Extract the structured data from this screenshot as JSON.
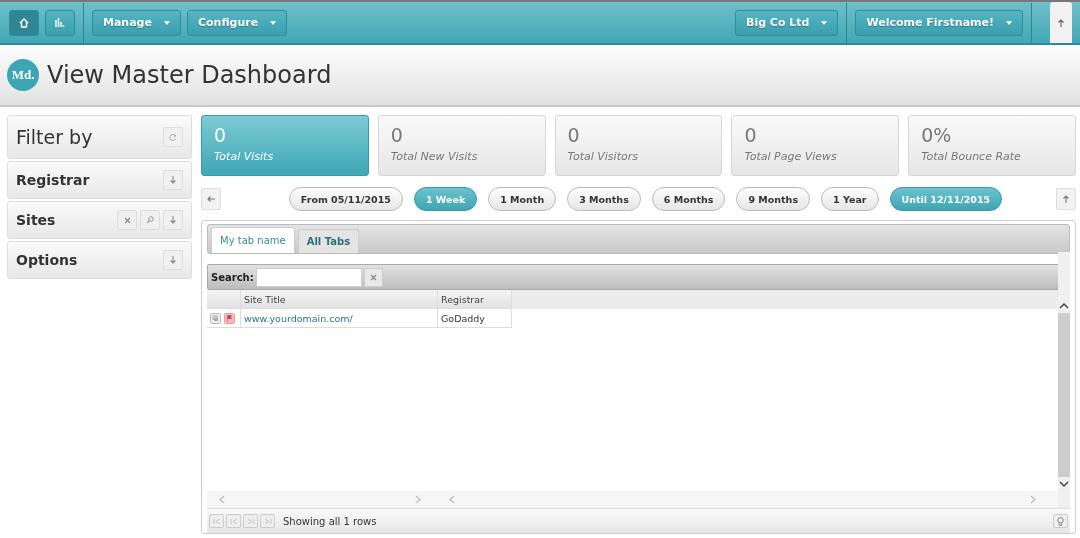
{
  "nav": {
    "menus": [
      {
        "label": "Manage"
      },
      {
        "label": "Configure"
      }
    ],
    "right_menus": [
      {
        "label": "Big Co Ltd"
      },
      {
        "label": "Welcome Firstname!"
      }
    ]
  },
  "header": {
    "logo": "Md.",
    "title": "View Master Dashboard"
  },
  "filter": {
    "title": "Filter by",
    "sections": [
      {
        "label": "Registrar",
        "kind": "collapsible"
      },
      {
        "label": "Sites",
        "kind": "searchable"
      },
      {
        "label": "Options",
        "kind": "collapsible"
      }
    ]
  },
  "stats": [
    {
      "value": "0",
      "label": "Total Visits",
      "selected": true
    },
    {
      "value": "0",
      "label": "Total New Visits",
      "selected": false
    },
    {
      "value": "0",
      "label": "Total Visitors",
      "selected": false
    },
    {
      "value": "0",
      "label": "Total Page Views",
      "selected": false
    },
    {
      "value": "0%",
      "label": "Total Bounce Rate",
      "selected": false
    }
  ],
  "periods": [
    {
      "label": "From 05/11/2015",
      "selected": false
    },
    {
      "label": "1 Week",
      "selected": true
    },
    {
      "label": "1 Month",
      "selected": false
    },
    {
      "label": "3 Months",
      "selected": false
    },
    {
      "label": "6 Months",
      "selected": false
    },
    {
      "label": "9 Months",
      "selected": false
    },
    {
      "label": "1 Year",
      "selected": false
    },
    {
      "label": "Until 12/11/2015",
      "selected": true
    }
  ],
  "tabs": [
    {
      "label": "My tab name",
      "selected": true
    },
    {
      "label": "All Tabs",
      "selected": false
    }
  ],
  "search": {
    "label": "Search:"
  },
  "table": {
    "columns": [
      "Site Title",
      "Registrar"
    ],
    "rows": [
      {
        "site": "www.yourdomain.com/",
        "registrar": "GoDaddy"
      }
    ]
  },
  "footer": {
    "status": "Showing all 1 rows"
  }
}
